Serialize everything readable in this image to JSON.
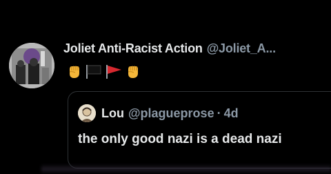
{
  "tweet": {
    "display_name": "Joliet Anti-Racist Action",
    "handle": "@Joliet_A...",
    "emojis": [
      "raised-fist",
      "black-flag",
      "red-triangular-flag",
      "raised-fist"
    ]
  },
  "quote": {
    "display_name": "Lou",
    "handle": "@plagueprose",
    "separator": "·",
    "time": "4d",
    "text": "the only good nazi is a dead nazi"
  },
  "colors": {
    "background": "#000000",
    "primary_text": "#e7e9ea",
    "secondary_text": "#8b98a5",
    "border": "#2f3336",
    "fist": "#f5b73a",
    "red_flag": "#d7282f"
  }
}
